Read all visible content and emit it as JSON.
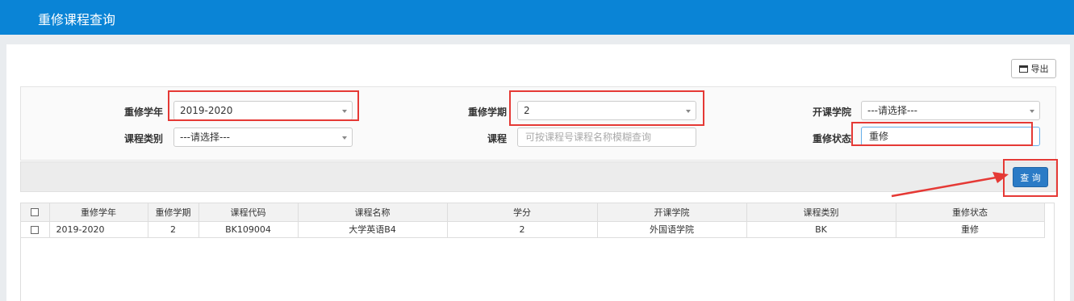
{
  "header": {
    "title": "重修课程查询"
  },
  "toolbar": {
    "export_label": "导出",
    "query_label": "查 询"
  },
  "filters": {
    "year": {
      "label": "重修学年",
      "value": "2019-2020"
    },
    "term": {
      "label": "重修学期",
      "value": "2"
    },
    "college": {
      "label": "开课学院",
      "value": "---请选择---"
    },
    "category": {
      "label": "课程类别",
      "value": "---请选择---"
    },
    "course": {
      "label": "课程",
      "placeholder": "可按课程号课程名称模糊查询"
    },
    "status": {
      "label": "重修状态",
      "value": "重修"
    }
  },
  "table": {
    "columns": [
      "重修学年",
      "重修学期",
      "课程代码",
      "课程名称",
      "学分",
      "开课学院",
      "课程类别",
      "重修状态"
    ],
    "rows": [
      {
        "year": "2019-2020",
        "term": "2",
        "code": "BK109004",
        "name": "大学英语B4",
        "credit": "2",
        "college": "外国语学院",
        "category": "BK",
        "status": "重修"
      }
    ]
  },
  "colors": {
    "header": "#0a84d6",
    "highlight": "#e53935",
    "button": "#2b7bc6"
  }
}
